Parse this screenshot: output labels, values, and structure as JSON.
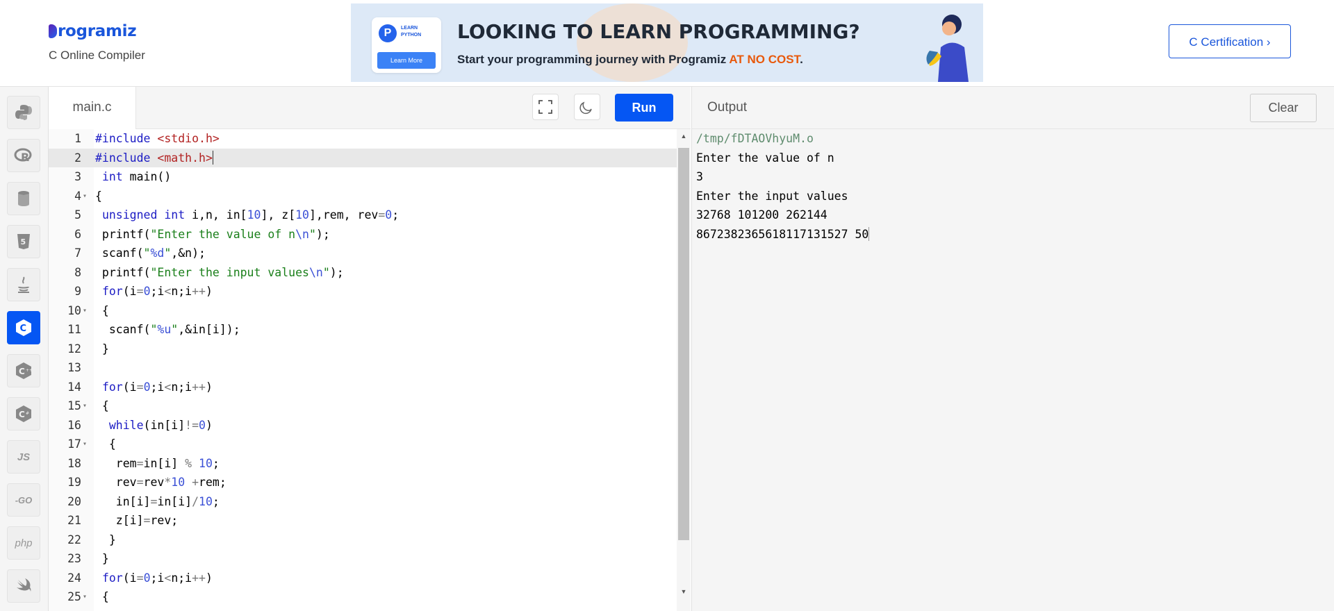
{
  "header": {
    "logo_text": "rogramiz",
    "subtitle": "C Online Compiler",
    "cert_button": "C Certification ›"
  },
  "banner": {
    "badge_line1": "LEARN",
    "badge_line2": "PYTHON",
    "learn_more": "Learn More",
    "headline": "LOOKING TO LEARN PROGRAMMING?",
    "sub_prefix": "Start your programming journey with Programiz ",
    "sub_highlight": "AT NO COST",
    "sub_suffix": "."
  },
  "sidebar": {
    "items": [
      {
        "name": "python-icon",
        "active": false
      },
      {
        "name": "r-icon",
        "active": false
      },
      {
        "name": "sql-icon",
        "active": false
      },
      {
        "name": "html5-icon",
        "active": false
      },
      {
        "name": "java-icon",
        "active": false
      },
      {
        "name": "c-icon",
        "active": true
      },
      {
        "name": "cpp-icon",
        "active": false
      },
      {
        "name": "csharp-icon",
        "active": false
      },
      {
        "name": "js-icon",
        "active": false,
        "text": "JS"
      },
      {
        "name": "go-icon",
        "active": false,
        "text": "-GO"
      },
      {
        "name": "php-icon",
        "active": false,
        "text": "php"
      },
      {
        "name": "swift-icon",
        "active": false
      }
    ]
  },
  "editor": {
    "file_tab": "main.c",
    "run_label": "Run",
    "active_line": 2,
    "lines": [
      {
        "n": "1",
        "fold": "",
        "code": "#include <stdio.h>"
      },
      {
        "n": "2",
        "fold": "",
        "code": "#include <math.h>"
      },
      {
        "n": "3",
        "fold": "",
        "code": " int main()"
      },
      {
        "n": "4",
        "fold": "▾",
        "code": "{"
      },
      {
        "n": "5",
        "fold": "",
        "code": " unsigned int i,n, in[10], z[10],rem, rev=0;"
      },
      {
        "n": "6",
        "fold": "",
        "code": " printf(\"Enter the value of n\\n\");"
      },
      {
        "n": "7",
        "fold": "",
        "code": " scanf(\"%d\",&n);"
      },
      {
        "n": "8",
        "fold": "",
        "code": " printf(\"Enter the input values\\n\");"
      },
      {
        "n": "9",
        "fold": "",
        "code": " for(i=0;i<n;i++)"
      },
      {
        "n": "10",
        "fold": "▾",
        "code": " {"
      },
      {
        "n": "11",
        "fold": "",
        "code": "  scanf(\"%u\",&in[i]);"
      },
      {
        "n": "12",
        "fold": "",
        "code": " }"
      },
      {
        "n": "13",
        "fold": "",
        "code": ""
      },
      {
        "n": "14",
        "fold": "",
        "code": " for(i=0;i<n;i++)"
      },
      {
        "n": "15",
        "fold": "▾",
        "code": " {"
      },
      {
        "n": "16",
        "fold": "",
        "code": "  while(in[i]!=0)"
      },
      {
        "n": "17",
        "fold": "▾",
        "code": "  {"
      },
      {
        "n": "18",
        "fold": "",
        "code": "   rem=in[i] % 10;"
      },
      {
        "n": "19",
        "fold": "",
        "code": "   rev=rev*10 +rem;"
      },
      {
        "n": "20",
        "fold": "",
        "code": "   in[i]=in[i]/10;"
      },
      {
        "n": "21",
        "fold": "",
        "code": "   z[i]=rev;"
      },
      {
        "n": "22",
        "fold": "",
        "code": "  }"
      },
      {
        "n": "23",
        "fold": "",
        "code": " }"
      },
      {
        "n": "24",
        "fold": "",
        "code": " for(i=0;i<n;i++)"
      },
      {
        "n": "25",
        "fold": "▾",
        "code": " {"
      }
    ]
  },
  "output": {
    "title": "Output",
    "clear_label": "Clear",
    "lines": [
      "/tmp/fDTAOVhyuM.o",
      "Enter the value of n",
      "3",
      "Enter the input values",
      "32768 101200 262144",
      "8672382365618117131527 50"
    ]
  },
  "colors": {
    "accent": "#0556f3",
    "keyword": "#1c1cc4",
    "string": "#1a7f1a",
    "include": "#b22222",
    "number": "#3b50d6"
  }
}
